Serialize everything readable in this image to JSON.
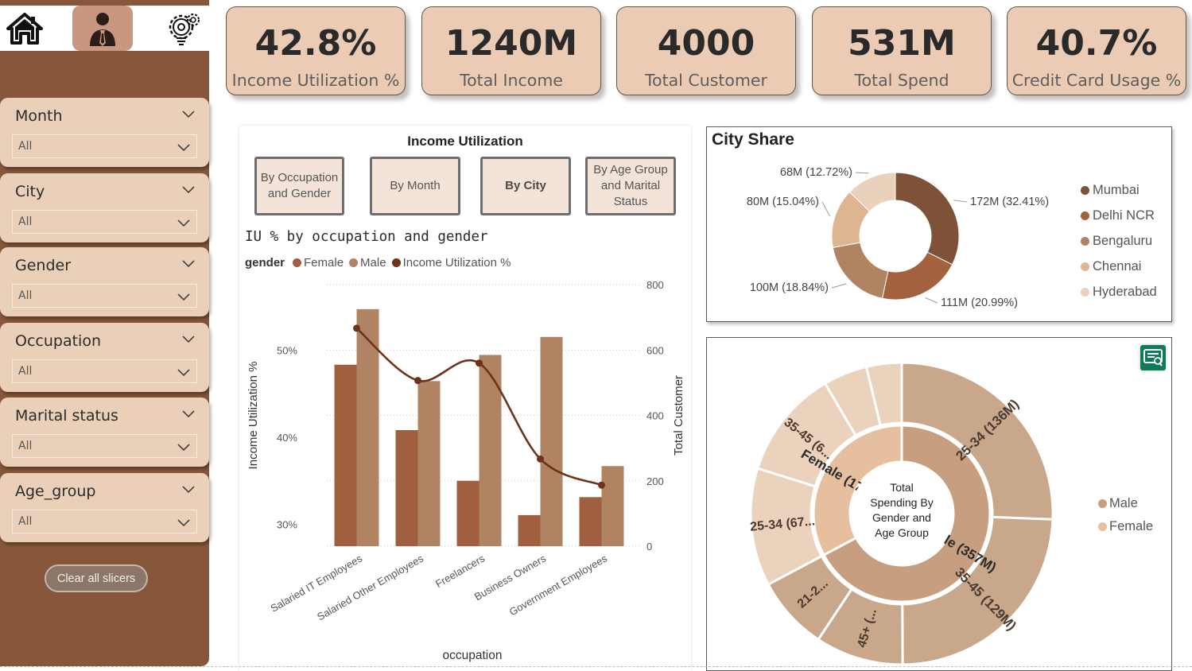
{
  "nav": {
    "home_icon": "home-icon",
    "user_icon": "user-icon",
    "settings_icon": "gear-bulb-icon"
  },
  "slicers": [
    {
      "title": "Month",
      "value": "All"
    },
    {
      "title": "City",
      "value": "All"
    },
    {
      "title": "Gender",
      "value": "All"
    },
    {
      "title": "Occupation",
      "value": "All"
    },
    {
      "title": "Marital status",
      "value": "All"
    },
    {
      "title": "Age_group",
      "value": "All"
    }
  ],
  "clear_button": "Clear all slicers",
  "kpis": [
    {
      "value": "42.8%",
      "label": "Income Utilization %"
    },
    {
      "value": "1240M",
      "label": "Total Income"
    },
    {
      "value": "4000",
      "label": "Total Customer"
    },
    {
      "value": "531M",
      "label": "Total Spend"
    },
    {
      "value": "40.7%",
      "label": "Credit Card Usage %"
    }
  ],
  "income_panel": {
    "title": "Income Utilization",
    "tabs": [
      {
        "label": "By Occupation and Gender",
        "active": false
      },
      {
        "label": "By Month",
        "active": false
      },
      {
        "label": "By City",
        "active": true
      },
      {
        "label": "By Age Group and Marital Status",
        "active": false
      }
    ],
    "subtitle": "IU % by occupation and gender",
    "legend_title": "gender",
    "legend": [
      {
        "label": "Female",
        "color": "#a0603f"
      },
      {
        "label": "Male",
        "color": "#b08463"
      },
      {
        "label": "Income Utilization %",
        "color": "#6e3218"
      }
    ]
  },
  "chart_data": [
    {
      "type": "bar",
      "title": "IU % by occupation and gender",
      "xlabel": "occupation",
      "ylabel": "Income Utilization %",
      "y2label": "Total Customer",
      "categories": [
        "Salaried IT Employees",
        "Salaried Other Employees",
        "Freelancers",
        "Business Owners",
        "Government Employees"
      ],
      "series": [
        {
          "name": "Female",
          "axis": "right",
          "values": [
            555,
            355,
            200,
            95,
            150
          ],
          "color": "#a0603f"
        },
        {
          "name": "Male",
          "axis": "right",
          "values": [
            725,
            505,
            585,
            640,
            245
          ],
          "color": "#b08463"
        },
        {
          "name": "Income Utilization %",
          "axis": "left",
          "type": "line",
          "values": [
            52.5,
            46.5,
            48.5,
            37.5,
            34.5
          ],
          "color": "#6e3218"
        }
      ],
      "y_left_ticks": [
        "30%",
        "40%",
        "50%"
      ],
      "y_left_tick_values": [
        30,
        40,
        50
      ],
      "y_left_range": [
        27.5,
        57.5
      ],
      "y_right_ticks": [
        "0",
        "200",
        "400",
        "600",
        "800"
      ],
      "y_right_range": [
        0,
        800
      ],
      "grid": true,
      "legend": "top-left"
    },
    {
      "type": "pie",
      "title": "City Share",
      "slices": [
        {
          "name": "Mumbai",
          "value": 172,
          "label": "172M (32.41%)",
          "color": "#7d5239"
        },
        {
          "name": "Delhi NCR",
          "value": 111,
          "label": "111M (20.99%)",
          "color": "#a3613e"
        },
        {
          "name": "Bengaluru",
          "value": 100,
          "label": "100M (18.84%)",
          "color": "#b08463"
        },
        {
          "name": "Chennai",
          "value": 80,
          "label": "80M (15.04%)",
          "color": "#ddb691"
        },
        {
          "name": "Hyderabad",
          "value": 68,
          "label": "68M (12.72%)",
          "color": "#ead1bb"
        }
      ],
      "legend": "right"
    },
    {
      "type": "sunburst",
      "center_label": "Total Spending By Gender and Age Group",
      "inner": [
        {
          "name": "Male",
          "value": 357,
          "label": "Male (357M)",
          "color": "#c79f80"
        },
        {
          "name": "Female",
          "value": 174,
          "label": "Female (174M)",
          "color": "#e6bf9f"
        }
      ],
      "outer": [
        {
          "parent": "Male",
          "value": 136,
          "label": "25-34 (136M)",
          "color": "#c8a78b"
        },
        {
          "parent": "Male",
          "value": 129,
          "label": "35-45 (129M)",
          "color": "#c8a78b"
        },
        {
          "parent": "Male",
          "value": 50,
          "label": "45+ (...",
          "color": "#c8a78b"
        },
        {
          "parent": "Male",
          "value": 42,
          "label": "21-2...",
          "color": "#c8a78b"
        },
        {
          "parent": "Female",
          "value": 67,
          "label": "25-34 (67...",
          "color": "#ead2bc"
        },
        {
          "parent": "Female",
          "value": 62,
          "label": "35-45 (6...",
          "color": "#ead2bc"
        },
        {
          "parent": "Female",
          "value": 25,
          "label": "",
          "color": "#ead2bc"
        },
        {
          "parent": "Female",
          "value": 20,
          "label": "",
          "color": "#ead2bc"
        }
      ],
      "legend": [
        {
          "label": "Male",
          "color": "#c79f80"
        },
        {
          "label": "Female",
          "color": "#e6bf9f"
        }
      ]
    }
  ],
  "city_panel": {
    "title": "City Share"
  }
}
